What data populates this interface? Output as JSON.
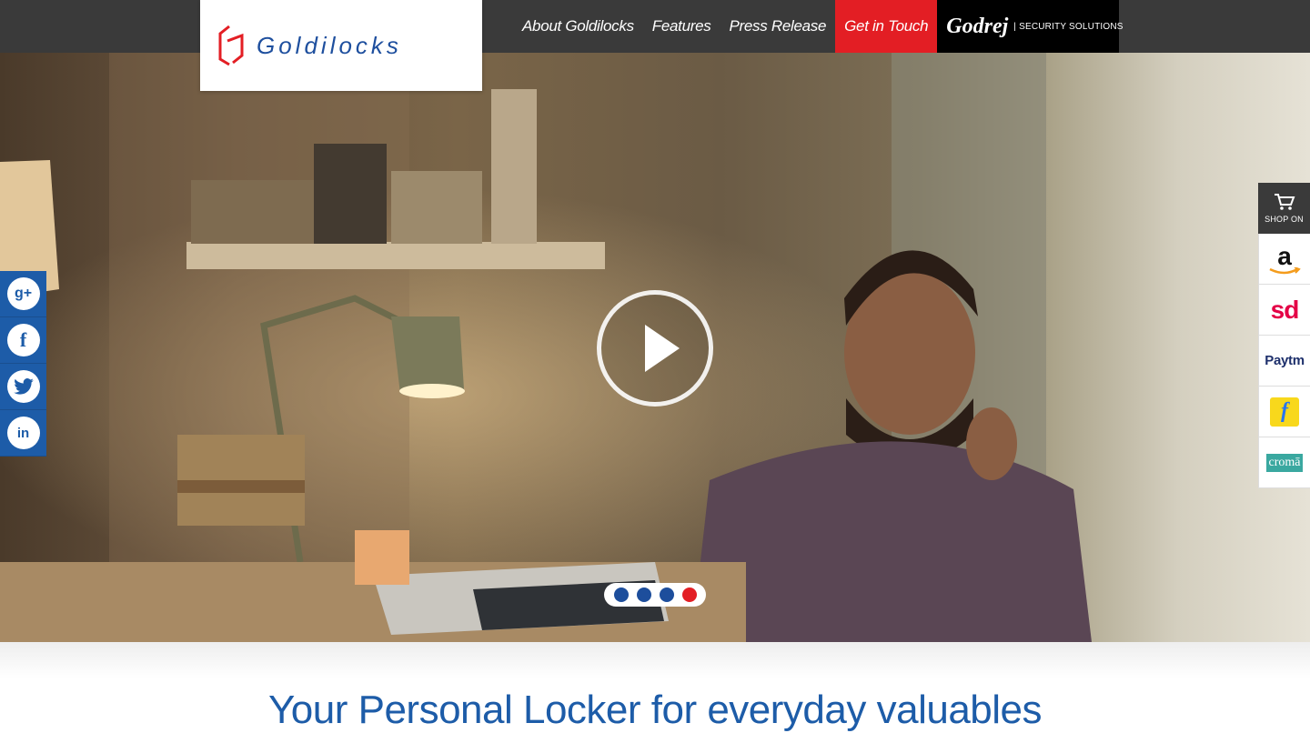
{
  "brand": {
    "logo_text": "Goldilocks",
    "partner_script": "Godrej",
    "partner_sub": "| SECURITY SOLUTIONS"
  },
  "nav": {
    "items": [
      {
        "label": "About Goldilocks"
      },
      {
        "label": "Features"
      },
      {
        "label": "Press Release"
      },
      {
        "label": "Get in Touch"
      }
    ]
  },
  "social": {
    "items": [
      {
        "icon": "google-plus-icon",
        "glyph": "g+"
      },
      {
        "icon": "facebook-icon",
        "glyph": "f"
      },
      {
        "icon": "twitter-icon",
        "glyph": "t"
      },
      {
        "icon": "linkedin-icon",
        "glyph": "in"
      }
    ]
  },
  "shop": {
    "title": "SHOP ON",
    "stores": [
      {
        "icon": "amazon-icon",
        "label": "a"
      },
      {
        "icon": "snapdeal-icon",
        "label": "sd"
      },
      {
        "icon": "paytm-icon",
        "label": "Paytm"
      },
      {
        "icon": "flipkart-icon",
        "label": "f"
      },
      {
        "icon": "croma-icon",
        "label": "cromā"
      }
    ]
  },
  "carousel": {
    "slides": 4,
    "active_index": 3
  },
  "tagline": "Your Personal Locker for everyday valuables",
  "colors": {
    "topbar": "#3a3a3a",
    "accent_red": "#e31e24",
    "brand_blue": "#1d4e9c",
    "social_blue": "#1d5ca8"
  }
}
